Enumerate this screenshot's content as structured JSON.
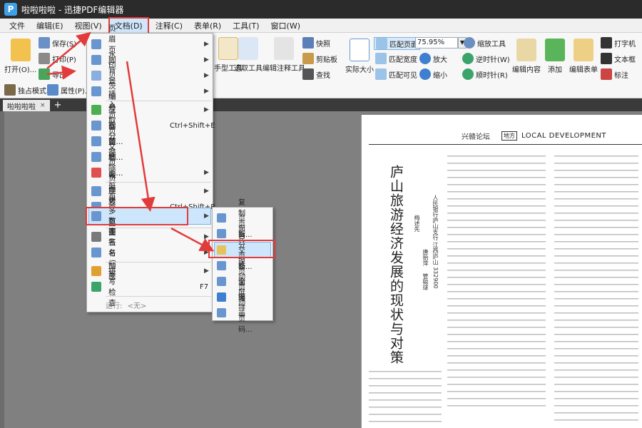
{
  "app": {
    "title": "啦啦啦啦 - 迅捷PDF编辑器"
  },
  "menubar": [
    "文件",
    "编辑(E)",
    "视图(V)",
    "文档(D)",
    "注释(C)",
    "表单(R)",
    "工具(T)",
    "窗口(W)"
  ],
  "ribbon": {
    "open": "打开(O)...",
    "save": "保存(S)",
    "print": "打印(P)",
    "export": "导出",
    "exclusive": "独占模式",
    "properties": "属性(P)...",
    "hand_tool": "手型工具",
    "select_tool": "选取工具",
    "edit_annot": "编辑注释工具",
    "snapshot": "快照",
    "clipboard": "剪贴板",
    "find": "查找",
    "actual_size": "实际大小",
    "fit_page": "匹配页面",
    "fit_width": "匹配宽度",
    "fit_visible": "匹配可见",
    "zoom_value": "75.95%",
    "zoom_tool": "缩放工具",
    "zoom_in": "放大",
    "zoom_out": "缩小",
    "rotate_ccw": "逆时针(W)",
    "rotate_cw": "顺时针(R)",
    "edit_content": "编辑内容",
    "add": "添加",
    "edit_form": "编辑表单",
    "typewriter": "打字机",
    "textbox": "文本框",
    "mark": "标注"
  },
  "tabs": {
    "doc_tab": "啦啦啦啦"
  },
  "doc_menu": {
    "items": [
      {
        "label": "页眉页脚",
        "shortcut": "",
        "arrow": true
      },
      {
        "label": "水印",
        "shortcut": "",
        "arrow": true
      },
      {
        "label": "背景",
        "shortcut": "",
        "arrow": true
      },
      {
        "label": "贝茨编号",
        "shortcut": "",
        "arrow": true
      },
      {
        "label": "插入页面",
        "shortcut": "",
        "arrow": true
      },
      {
        "label": "提取页面...",
        "shortcut": "Ctrl+Shift+E",
        "arrow": false
      },
      {
        "label": "拆分文档...",
        "shortcut": "",
        "arrow": false
      },
      {
        "label": "替换页面...",
        "shortcut": "",
        "arrow": false
      },
      {
        "label": "删除页面",
        "shortcut": "",
        "arrow": true
      },
      {
        "label": "裁剪页面",
        "shortcut": "",
        "arrow": true
      },
      {
        "label": "旋转页面...",
        "shortcut": "Ctrl+Shift+R",
        "arrow": false
      },
      {
        "label": "更多页面",
        "shortcut": "",
        "arrow": true
      },
      {
        "label": "数字签名",
        "shortcut": "",
        "arrow": true
      },
      {
        "label": "签名与缩写",
        "shortcut": "",
        "arrow": true
      },
      {
        "label": "加密",
        "shortcut": "",
        "arrow": true
      },
      {
        "label": "拼写检查",
        "shortcut": "F7",
        "arrow": false
      }
    ],
    "run_label": "运行:",
    "run_value": "<无>"
  },
  "more_pages_menu": [
    "复制页面...",
    "页面尺寸...",
    "拆分页面...",
    "交换页面",
    "移动页面",
    "全屏动画",
    "编排页码..."
  ],
  "document": {
    "header_cn": "兴赣论坛",
    "header_box": "地方",
    "header_en": "LOCAL DEVELOPMENT",
    "title": "庐山旅游经济发展的现状与对策",
    "author1": "梅述先",
    "author2": "唐贻萍",
    "author3": "管聪球",
    "org": "人民银行庐山支行  江西庐山  332900"
  },
  "colors": {
    "accent_red": "#e23b3b",
    "highlight": "#cde6fb",
    "titlebar": "#2b2b2b"
  }
}
